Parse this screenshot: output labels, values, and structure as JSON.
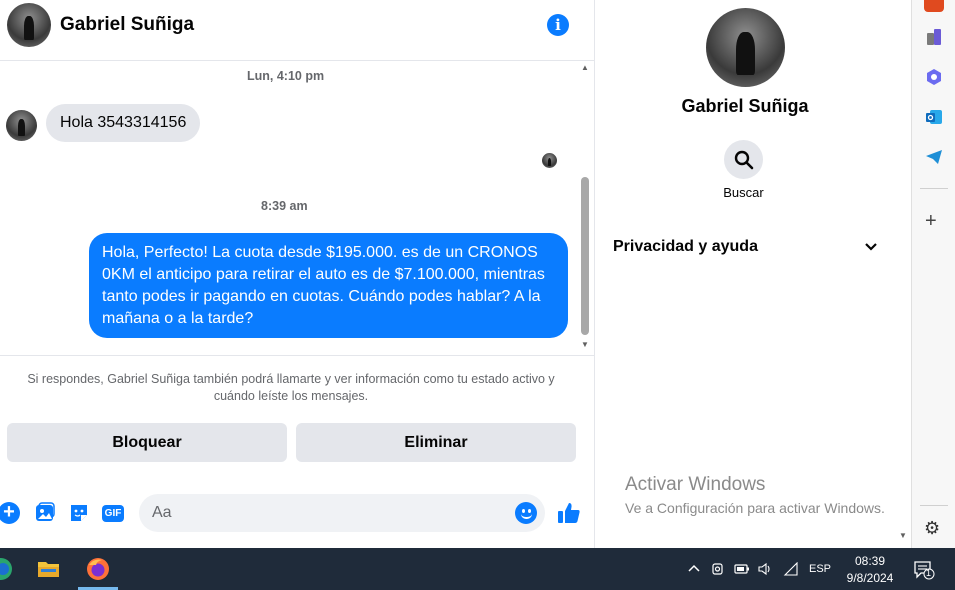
{
  "chat": {
    "contact_name": "Gabriel Suñiga",
    "timestamps": [
      "Lun, 4:10 pm",
      "8:39 am"
    ],
    "incoming_message": "Hola 3543314156",
    "outgoing_message": "Hola, Perfecto! La cuota desde $195.000. es de un CRONOS 0KM el anticipo para retirar el auto es de $7.100.000, mientras tanto podes ir pagando en cuotas. Cuándo podes hablar? A la mañana o a la tarde?",
    "notice": "Si respondes, Gabriel Suñiga también podrá llamarte y ver información como tu estado activo y cuándo leíste los mensajes.",
    "block_label": "Bloquear",
    "delete_label": "Eliminar",
    "composer_placeholder": "Aa",
    "gif_label": "GIF",
    "accent_color": "#0a7cff"
  },
  "info_pane": {
    "name": "Gabriel Suñiga",
    "search_label": "Buscar",
    "privacy_label": "Privacidad y ayuda",
    "watermark_title": "Activar Windows",
    "watermark_sub": "Ve a Configuración para activar Windows."
  },
  "edge_sidebar": {
    "icons": [
      "office-icon",
      "games-icon",
      "copilot-icon",
      "outlook-icon",
      "telegram-icon",
      "add-icon",
      "settings-icon"
    ]
  },
  "taskbar": {
    "language": "ESP",
    "time": "08:39",
    "date": "9/8/2024",
    "notification_count": "1",
    "pinned": [
      "edge-icon",
      "file-explorer-icon",
      "firefox-icon"
    ]
  }
}
